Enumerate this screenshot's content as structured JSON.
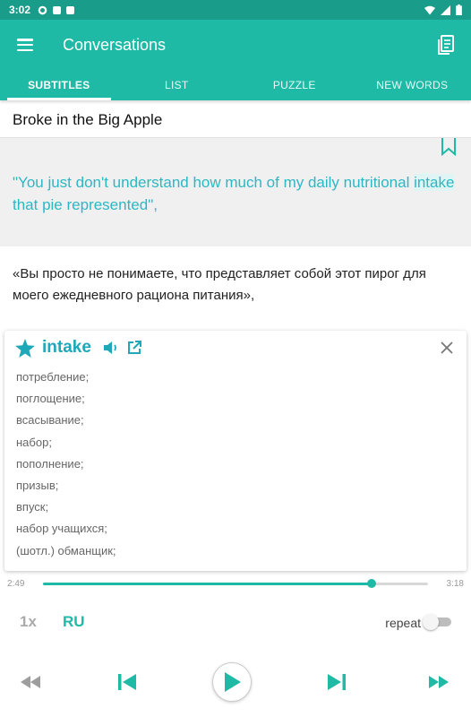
{
  "status_bar": {
    "time": "3:02"
  },
  "app_bar": {
    "title": "Conversations"
  },
  "tabs": [
    {
      "label": "SUBTITLES",
      "active": true
    },
    {
      "label": "LIST",
      "active": false
    },
    {
      "label": "PUZZLE",
      "active": false
    },
    {
      "label": "NEW WORDS",
      "active": false
    }
  ],
  "book": {
    "title": "Broke in the Big Apple"
  },
  "subtitle": {
    "before": "\"You just don't understand how much of my daily nutritional ",
    "highlight": "intake",
    "after": " that pie represented\","
  },
  "translation": "«Вы просто не понимаете, что представляет собой этот пирог для моего ежедневного рациона питания»,",
  "dictionary": {
    "word": "intake",
    "meanings": [
      "потребление;",
      "поглощение;",
      "всасывание;",
      "набор;",
      "пополнение;",
      "призыв;",
      "впуск;",
      "набор учащихся;",
      "(шотл.) обманщик;"
    ]
  },
  "progress": {
    "current": "2:49",
    "total": "3:18",
    "fraction": 0.853
  },
  "controls": {
    "speed": "1x",
    "language": "RU",
    "repeat_label": "repeat",
    "repeat_on": false
  },
  "colors": {
    "accent": "#1fbaa6",
    "status_bar": "#1a9c8a",
    "subtitle_text": "#2bb8c4"
  }
}
